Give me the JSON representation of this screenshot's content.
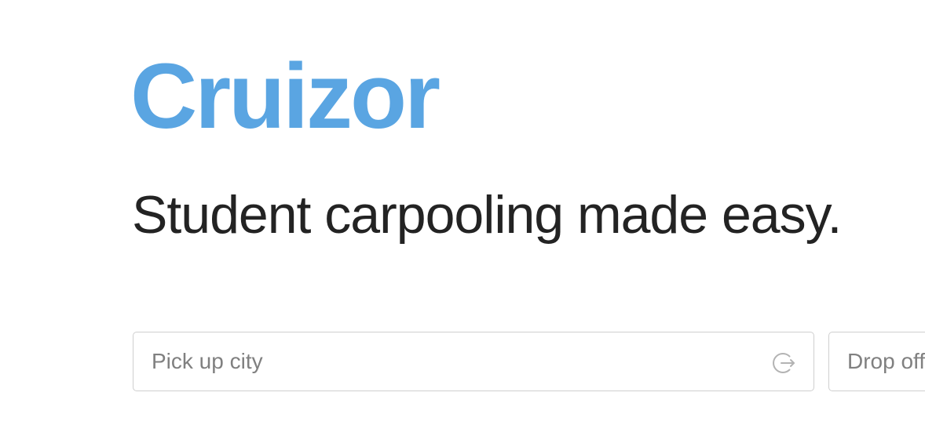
{
  "brand": {
    "name": "Cruizor",
    "color": "#5aa5e2"
  },
  "hero": {
    "tagline": "Student carpooling made easy."
  },
  "search": {
    "pickup": {
      "placeholder": "Pick up city",
      "value": "",
      "icon": "locate-icon"
    },
    "dropoff": {
      "placeholder": "Drop off city",
      "value": ""
    }
  }
}
